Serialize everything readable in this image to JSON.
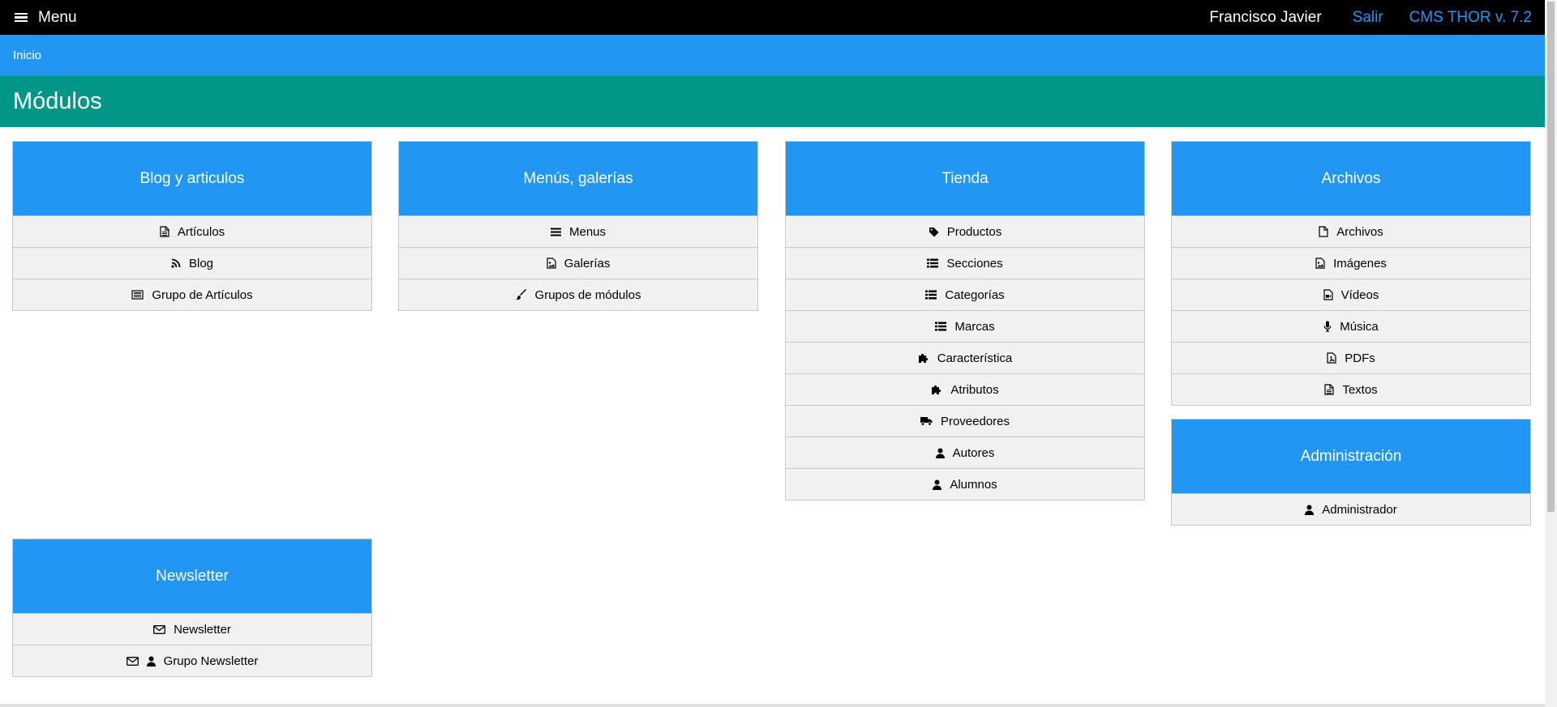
{
  "topbar": {
    "menu_label": "Menu",
    "user_name": "Francisco Javier",
    "logout_label": "Salir",
    "version_label": "CMS THOR v. 7.2"
  },
  "breadcrumb": {
    "home_label": "Inicio"
  },
  "page": {
    "title": "Módulos"
  },
  "colors": {
    "topbar": "#000000",
    "breadcrumb": "#2196f3",
    "title": "#009688",
    "card_header": "#2196f3",
    "link": "#2196f3",
    "item_bg": "#f1f1f1"
  },
  "cards": [
    {
      "title": "Blog y articulos",
      "items": [
        {
          "label": "Artículos",
          "icons": [
            "document-icon"
          ]
        },
        {
          "label": "Blog",
          "icons": [
            "rss-icon"
          ]
        },
        {
          "label": "Grupo de Artículos",
          "icons": [
            "newspaper-icon"
          ]
        }
      ]
    },
    {
      "title": "Menús, galerías",
      "items": [
        {
          "label": "Menus",
          "icons": [
            "bars-icon"
          ]
        },
        {
          "label": "Galerías",
          "icons": [
            "image-icon"
          ]
        },
        {
          "label": "Grupos de módulos",
          "icons": [
            "brush-icon"
          ]
        }
      ]
    },
    {
      "title": "Tienda",
      "items": [
        {
          "label": "Productos",
          "icons": [
            "tag-icon"
          ]
        },
        {
          "label": "Secciones",
          "icons": [
            "list-icon"
          ]
        },
        {
          "label": "Categorías",
          "icons": [
            "list-icon"
          ]
        },
        {
          "label": "Marcas",
          "icons": [
            "list-icon"
          ]
        },
        {
          "label": "Característica",
          "icons": [
            "puzzle-icon"
          ]
        },
        {
          "label": "Atributos",
          "icons": [
            "puzzle-icon"
          ]
        },
        {
          "label": "Proveedores",
          "icons": [
            "truck-icon"
          ]
        },
        {
          "label": "Autores",
          "icons": [
            "user-icon"
          ]
        },
        {
          "label": "Alumnos",
          "icons": [
            "user-icon"
          ]
        }
      ]
    },
    {
      "title": "Archivos",
      "items": [
        {
          "label": "Archivos",
          "icons": [
            "file-icon"
          ]
        },
        {
          "label": "Imágenes",
          "icons": [
            "image-icon"
          ]
        },
        {
          "label": "Vídeos",
          "icons": [
            "video-file-icon"
          ]
        },
        {
          "label": "Música",
          "icons": [
            "microphone-icon"
          ]
        },
        {
          "label": "PDFs",
          "icons": [
            "pdf-icon"
          ]
        },
        {
          "label": "Textos",
          "icons": [
            "document-icon"
          ]
        }
      ]
    },
    {
      "title": "Administración",
      "items": [
        {
          "label": "Administrador",
          "icons": [
            "user-icon"
          ]
        }
      ]
    },
    {
      "title": "Newsletter",
      "items": [
        {
          "label": "Newsletter",
          "icons": [
            "envelope-icon"
          ]
        },
        {
          "label": "Grupo Newsletter",
          "icons": [
            "envelope-icon",
            "user-icon"
          ]
        }
      ]
    }
  ]
}
